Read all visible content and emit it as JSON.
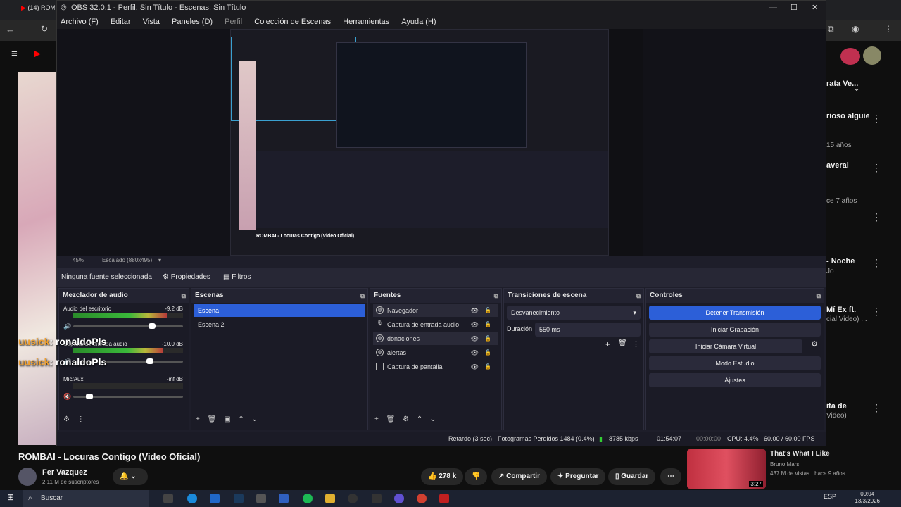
{
  "browser": {
    "tab_title": "(14) ROM",
    "zoom": "",
    "side_items": [
      {
        "title": "rioso alguien",
        "sub": "15 años"
      },
      {
        "title": "averal",
        "sub": "ce 7 años"
      },
      {
        "title": "- Noche",
        "sub": "Jo"
      },
      {
        "title": "Mí Ex ft.",
        "sub": "cial Video) ..."
      },
      {
        "title": "ita de",
        "sub": "Video)"
      },
      {
        "title": "rata Ve...",
        "sub": ""
      }
    ]
  },
  "obs": {
    "title": "OBS 32.0.1 - Perfil: Sin Título - Escenas: Sin Título",
    "menu": [
      "Archivo (F)",
      "Editar",
      "Vista",
      "Paneles (D)",
      "Perfil",
      "Colección de Escenas",
      "Herramientas",
      "Ayuda (H)"
    ],
    "scale_text": "45%",
    "scale_label": "Escalado (880x495)",
    "no_source": "Ninguna fuente seleccionada",
    "properties": "Propiedades",
    "filters": "Filtros",
    "docks": {
      "mixer": {
        "title": "Mezclador de audio",
        "channels": [
          {
            "name": "Audio del escritorio",
            "db": "-9.2 dB",
            "level": 0.85,
            "vol": 0.72
          },
          {
            "name": "Captura de entrada audio",
            "db": "-10.0 dB",
            "level": 0.82,
            "vol": 0.7
          },
          {
            "name": "Mic/Aux",
            "db": "-inf dB",
            "level": 0.0,
            "vol": 0.15
          }
        ]
      },
      "scenes": {
        "title": "Escenas",
        "items": [
          "Escena",
          "Escena 2"
        ]
      },
      "sources": {
        "title": "Fuentes",
        "items": [
          "Navegador",
          "Captura de entrada audio",
          "donaciones",
          "alertas",
          "Captura de pantalla"
        ]
      },
      "transitions": {
        "title": "Transiciones de escena",
        "selected": "Desvanecimiento",
        "duration_label": "Duración",
        "duration_value": "550 ms"
      },
      "controls": {
        "title": "Controles",
        "buttons": [
          "Detener Transmisión",
          "Iniciar Grabación",
          "Iniciar Cámara Virtual",
          "Modo Estudio",
          "Ajustes"
        ]
      }
    },
    "status": {
      "delay": "Retardo (3 sec)",
      "dropped": "Fotogramas Perdidos 1484 (0.4%)",
      "bitrate": "8785 kbps",
      "live_time": "01:54:07",
      "rec_time": "00:00:00",
      "cpu": "CPU: 4.4%",
      "fps": "60.00 / 60.00 FPS"
    }
  },
  "chat": [
    {
      "nick": "uusick",
      "msg": ": ronaldoPls"
    },
    {
      "nick": "uusick",
      "msg": ": ronaldoPls"
    }
  ],
  "youtube": {
    "video_title": "ROMBAI - Locuras Contigo (Video Oficial)",
    "channel": "Fer Vazquez",
    "subs": "2.11 M de suscriptores",
    "likes": "278 k",
    "share": "Compartir",
    "ask": "Preguntar",
    "save": "Guardar",
    "next_title": "That's What I Like",
    "next_channel": "Bruno Mars",
    "next_meta": "437 M de vistas · hace 9 años",
    "next_duration": "3:27"
  },
  "taskbar": {
    "search": "Buscar",
    "lang": "ESP",
    "time": "00:04",
    "date": "13/3/2026"
  }
}
